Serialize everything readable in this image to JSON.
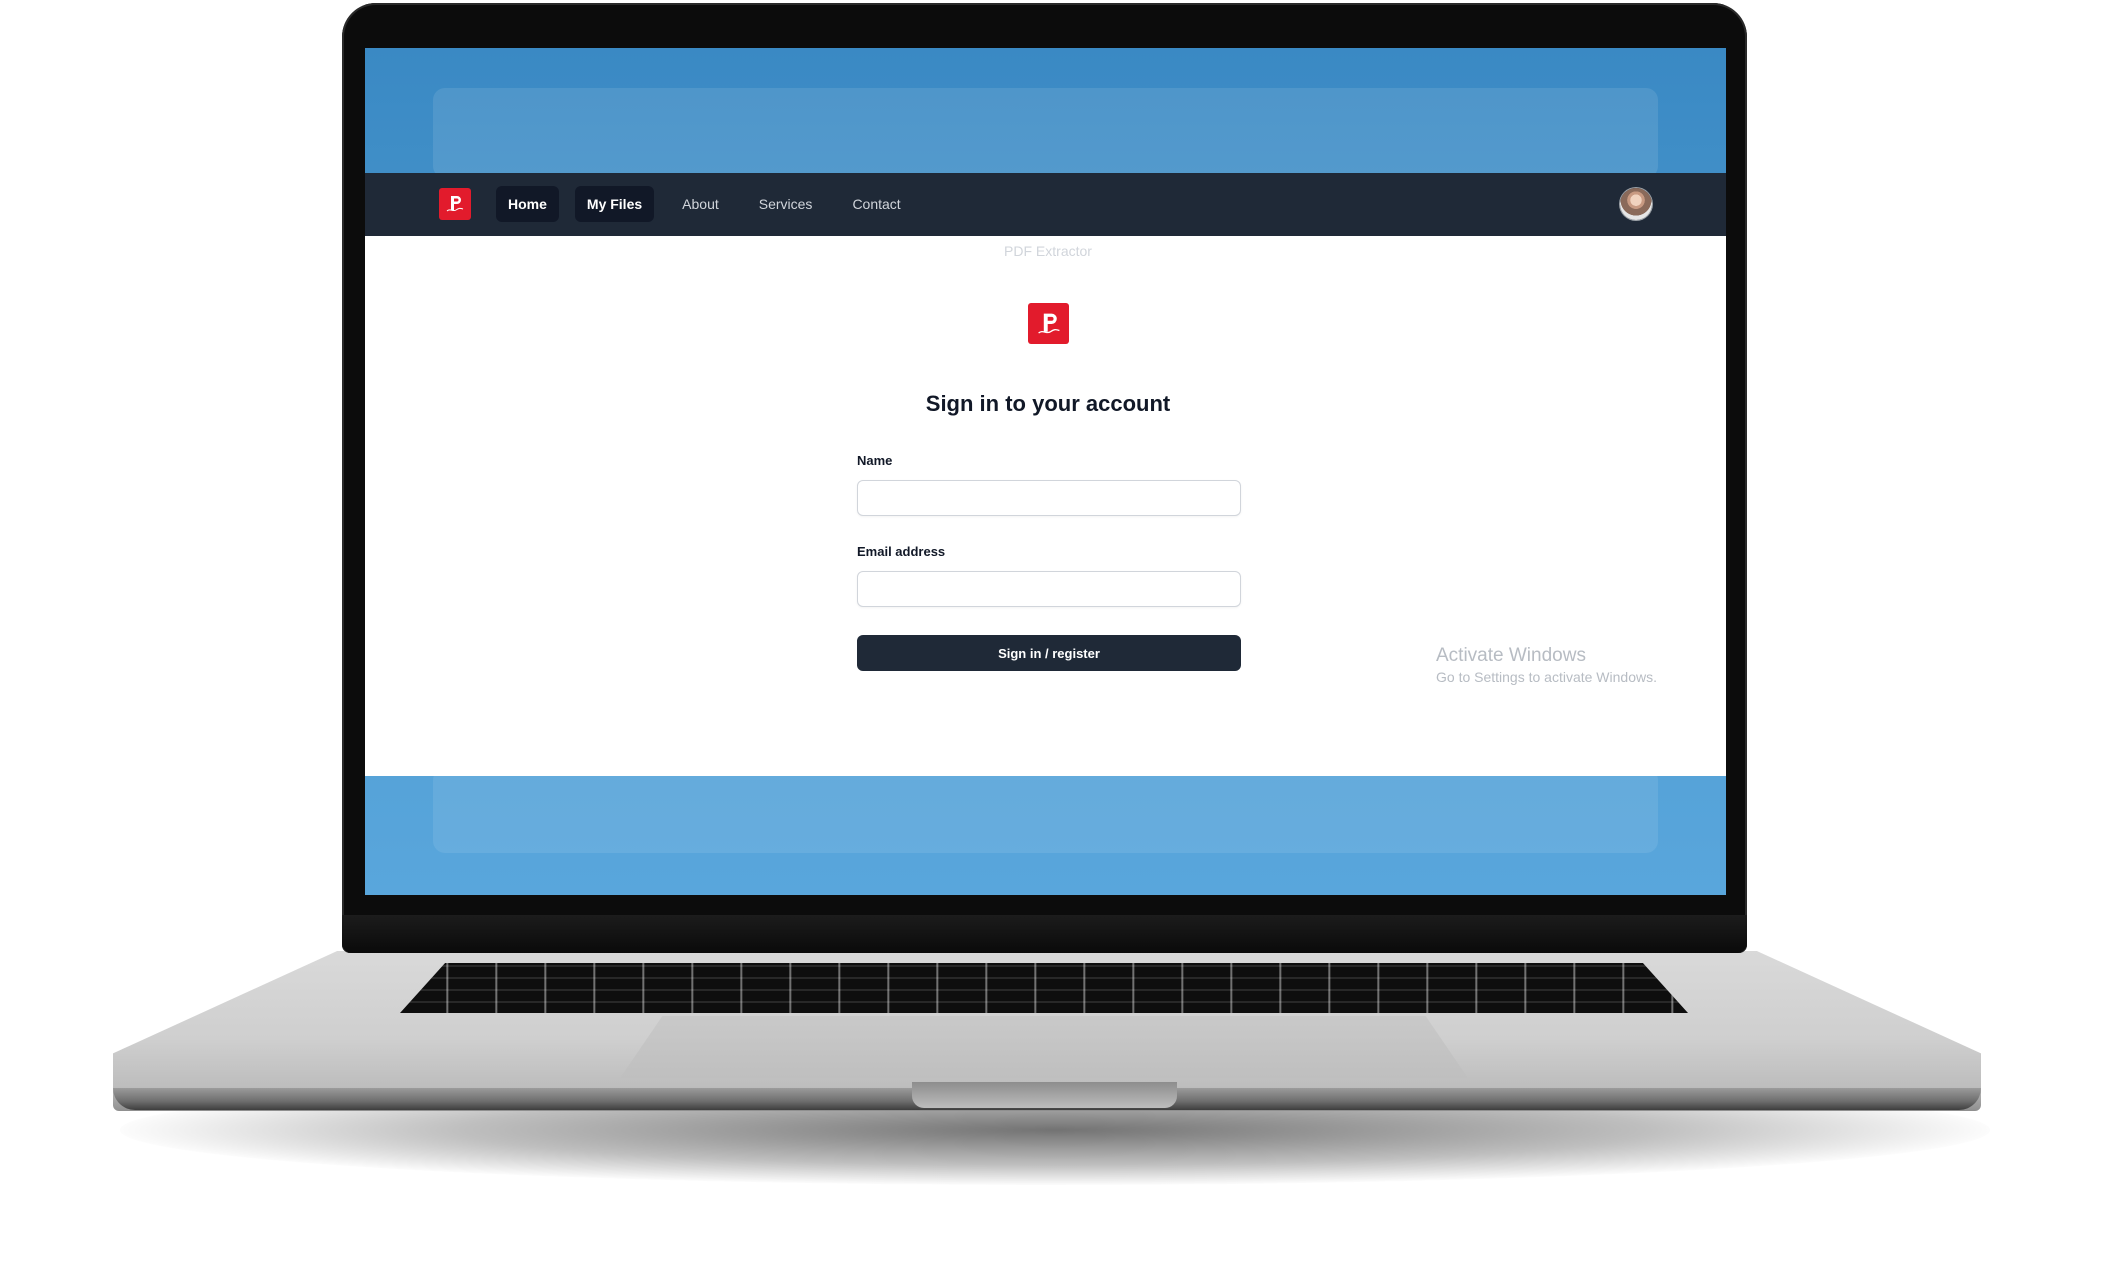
{
  "colors": {
    "navbar_bg": "#1f2937",
    "nav_active_bg": "#111827",
    "brand_red": "#e21b2c",
    "screen_blue": "#4a98cd",
    "primary_button": "#1f2937"
  },
  "navbar": {
    "logo_icon": "pdf-editor-logo-icon",
    "links": [
      {
        "label": "Home",
        "active": true
      },
      {
        "label": "My Files",
        "active": true
      },
      {
        "label": "About",
        "active": false
      },
      {
        "label": "Services",
        "active": false
      },
      {
        "label": "Contact",
        "active": false
      }
    ],
    "avatar_icon": "user-avatar"
  },
  "page": {
    "caption": "PDF Extractor",
    "title": "Sign in to your account"
  },
  "form": {
    "name_label": "Name",
    "name_value": "",
    "email_label": "Email address",
    "email_value": "",
    "submit_label": "Sign in / register"
  },
  "watermark": {
    "title": "Activate Windows",
    "subtitle": "Go to Settings to activate Windows."
  }
}
